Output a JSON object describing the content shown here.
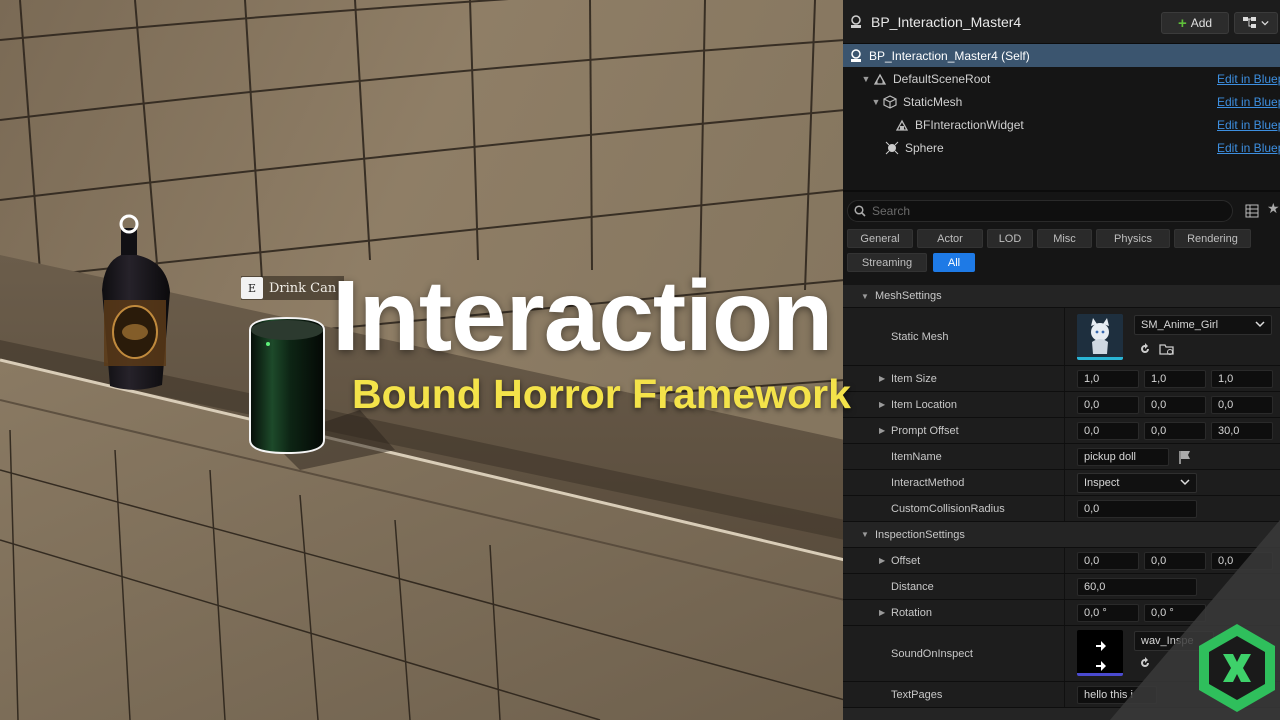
{
  "viewport": {
    "prompt_key": "E",
    "prompt_text": "Drink Can"
  },
  "overlay": {
    "title": "Interaction",
    "subtitle": "Bound Horror Framework"
  },
  "header": {
    "title": "BP_Interaction_Master4",
    "add_label": "Add"
  },
  "components": [
    {
      "name": "BP_Interaction_Master4 (Self)",
      "link": ""
    },
    {
      "name": "DefaultSceneRoot",
      "link": "Edit in Bluep"
    },
    {
      "name": "StaticMesh",
      "link": "Edit in Bluep"
    },
    {
      "name": "BFInteractionWidget",
      "link": "Edit in Bluep"
    },
    {
      "name": "Sphere",
      "link": "Edit in Bluep"
    }
  ],
  "details": {
    "search_placeholder": "Search",
    "filters": [
      "General",
      "Actor",
      "LOD",
      "Misc",
      "Physics",
      "Rendering",
      "Streaming",
      "All"
    ],
    "active_filter": "All",
    "mesh_settings": {
      "header": "MeshSettings",
      "static_mesh_label": "Static Mesh",
      "static_mesh_value": "SM_Anime_Girl",
      "item_size_label": "Item Size",
      "item_size": [
        "1,0",
        "1,0",
        "1,0"
      ],
      "item_location_label": "Item Location",
      "item_location": [
        "0,0",
        "0,0",
        "0,0"
      ],
      "prompt_offset_label": "Prompt Offset",
      "prompt_offset": [
        "0,0",
        "0,0",
        "30,0"
      ],
      "item_name_label": "ItemName",
      "item_name": "pickup doll",
      "interact_method_label": "InteractMethod",
      "interact_method": "Inspect",
      "collision_label": "CustomCollisionRadius",
      "collision": "0,0"
    },
    "inspection_settings": {
      "header": "InspectionSettings",
      "offset_label": "Offset",
      "offset": [
        "0,0",
        "0,0",
        "0,0"
      ],
      "distance_label": "Distance",
      "distance": "60,0",
      "rotation_label": "Rotation",
      "rotation": [
        "0,0 °",
        "0,0 °"
      ],
      "sound_label": "SoundOnInspect",
      "sound_value": "wav_Inspe",
      "text_pages_label": "TextPages",
      "text_pages_value": "hello this i"
    }
  },
  "colors": {
    "selection": "#3b556f",
    "link": "#3d8fe0",
    "active_filter": "#1e7ae6",
    "subtitle": "#f4e34a",
    "logo": "#3ed16a"
  }
}
